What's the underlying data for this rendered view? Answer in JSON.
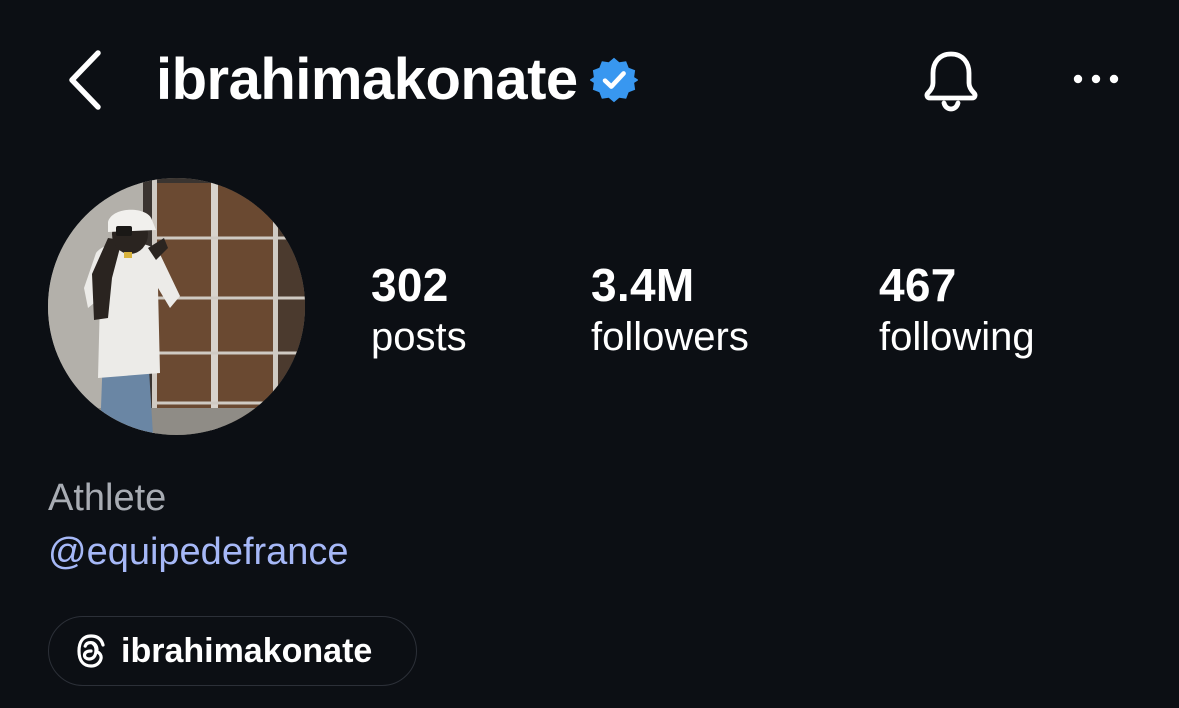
{
  "header": {
    "username": "ibrahimakonate",
    "verified": true,
    "icons": {
      "back": "chevron-left-icon",
      "verified": "verified-badge-icon",
      "notifications": "bell-icon",
      "more": "more-horizontal-icon"
    }
  },
  "profile": {
    "stats": [
      {
        "value": "302",
        "label": "posts"
      },
      {
        "value": "3.4M",
        "label": "followers"
      },
      {
        "value": "467",
        "label": "following"
      }
    ],
    "bio": {
      "category": "Athlete",
      "mention": "@equipedefrance"
    },
    "threads": {
      "icon": "threads-icon",
      "label": "ibrahimakonate"
    }
  },
  "colors": {
    "background": "#0c0f14",
    "text": "#ffffff",
    "muted": "#a8acb3",
    "link": "#a6b8f7",
    "verified": "#3897f0"
  }
}
